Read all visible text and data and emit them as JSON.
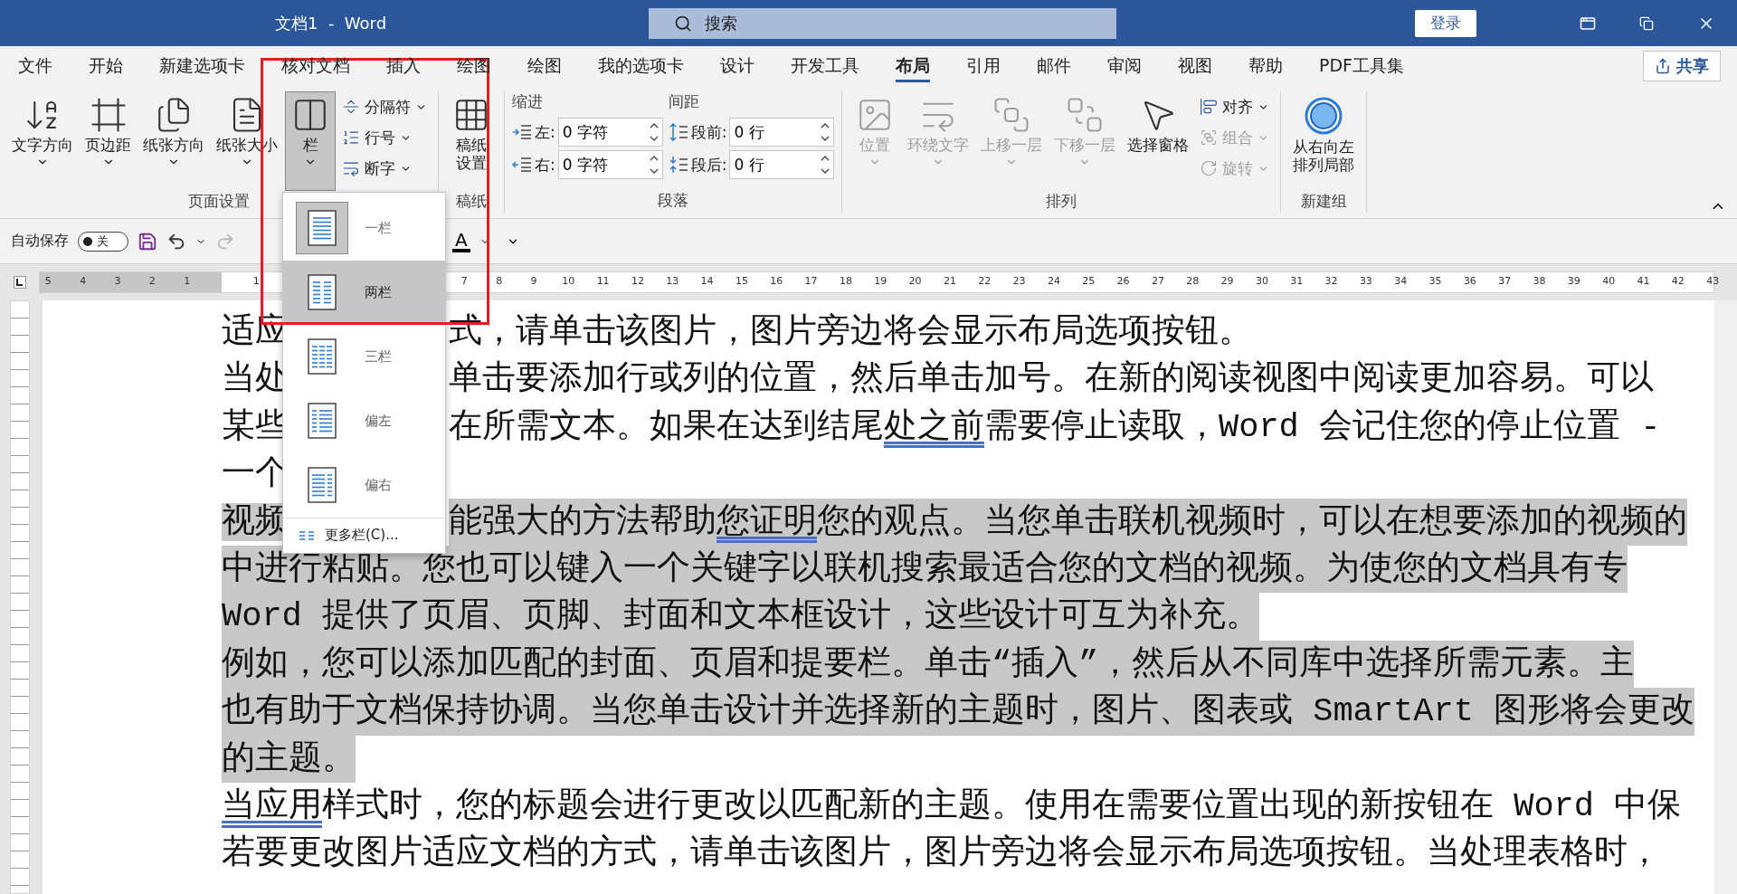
{
  "title_bar": {
    "title": "文档1  -  Word",
    "search": {
      "placeholder": "搜索"
    },
    "sign_in": "登录"
  },
  "tabs": [
    {
      "label": "文件",
      "selected": false
    },
    {
      "label": "开始",
      "selected": false
    },
    {
      "label": "新建选项卡",
      "selected": false
    },
    {
      "label": "核对文档",
      "selected": false
    },
    {
      "label": "插入",
      "selected": false
    },
    {
      "label": "绘图",
      "selected": false
    },
    {
      "label": "绘图",
      "selected": false
    },
    {
      "label": "我的选项卡",
      "selected": false
    },
    {
      "label": "设计",
      "selected": false
    },
    {
      "label": "开发工具",
      "selected": false
    },
    {
      "label": "布局",
      "selected": true
    },
    {
      "label": "引用",
      "selected": false
    },
    {
      "label": "邮件",
      "selected": false
    },
    {
      "label": "审阅",
      "selected": false
    },
    {
      "label": "视图",
      "selected": false
    },
    {
      "label": "帮助",
      "selected": false
    },
    {
      "label": "PDF工具集",
      "selected": false
    }
  ],
  "share": "共享",
  "ribbon": {
    "groups": [
      {
        "kind": "buttons",
        "label": "页面设置",
        "large": [
          {
            "label": "文字方向",
            "dropdown": true,
            "pressed": false,
            "disabled": false
          },
          {
            "label": "页边距",
            "dropdown": true,
            "pressed": false,
            "disabled": false
          },
          {
            "label": "纸张方向",
            "dropdown": true,
            "pressed": false,
            "disabled": false
          },
          {
            "label": "纸张大小",
            "dropdown": true,
            "pressed": false,
            "disabled": false
          },
          {
            "label": "栏",
            "dropdown": true,
            "pressed": true,
            "disabled": false
          }
        ],
        "small": [
          {
            "label": "分隔符",
            "dropdown": true,
            "disabled": false
          },
          {
            "label": "行号",
            "dropdown": true,
            "disabled": false
          },
          {
            "label": "断字",
            "dropdown": true,
            "disabled": false
          }
        ]
      },
      {
        "kind": "buttons",
        "label": "稿纸",
        "large": [
          {
            "label": "稿纸设置",
            "two_lines": true,
            "dropdown": false,
            "pressed": false,
            "disabled": false
          }
        ]
      },
      {
        "kind": "paragraph",
        "label": "段落",
        "indent_heading": "缩进",
        "spacing_heading": "间距",
        "indent": [
          {
            "label": "左:",
            "value": "0 字符"
          },
          {
            "label": "右:",
            "value": "0 字符"
          }
        ],
        "spacing": [
          {
            "label": "段前:",
            "value": "0 行"
          },
          {
            "label": "段后:",
            "value": "0 行"
          }
        ]
      },
      {
        "kind": "buttons",
        "label": "排列",
        "large": [
          {
            "label": "位置",
            "dropdown": true,
            "pressed": false,
            "disabled": true
          },
          {
            "label": "环绕文字",
            "dropdown": true,
            "pressed": false,
            "disabled": true
          },
          {
            "label": "上移一层",
            "dropdown": true,
            "pressed": false,
            "disabled": true
          },
          {
            "label": "下移一层",
            "dropdown": true,
            "pressed": false,
            "disabled": true
          },
          {
            "label": "选择窗格",
            "dropdown": false,
            "pressed": false,
            "disabled": false
          }
        ],
        "small": [
          {
            "label": "对齐",
            "dropdown": true,
            "disabled": false
          },
          {
            "label": "组合",
            "dropdown": true,
            "disabled": true
          },
          {
            "label": "旋转",
            "dropdown": true,
            "disabled": true
          }
        ]
      },
      {
        "kind": "buttons",
        "label": "新建组",
        "large": [
          {
            "label": "从右向左排列局部",
            "two_lines": true,
            "dropdown": false,
            "pressed": false,
            "disabled": false
          }
        ]
      }
    ]
  },
  "quick_access": {
    "autosave": "自动保存",
    "toggle": {
      "label": "关",
      "on": false
    },
    "font_color": "A"
  },
  "ruler": {
    "left_numbers": [
      "5",
      "4",
      "3",
      "2",
      "1"
    ],
    "right_numbers_before_menu": [
      "1"
    ],
    "right_numbers": [
      "7",
      "8",
      "9",
      "10",
      "11",
      "12",
      "13",
      "14",
      "15",
      "16",
      "17",
      "18",
      "19",
      "20",
      "21",
      "22",
      "23",
      "24",
      "25",
      "26",
      "27",
      "28",
      "29",
      "30",
      "31",
      "32",
      "33",
      "34",
      "35",
      "36",
      "37",
      "38",
      "39",
      "40",
      "41",
      "42",
      "43"
    ]
  },
  "columns_menu": {
    "items": [
      {
        "label": "一栏",
        "selected": true,
        "hovered": false
      },
      {
        "label": "两栏",
        "selected": false,
        "hovered": true
      },
      {
        "label": "三栏",
        "selected": false,
        "hovered": false
      },
      {
        "label": "偏左",
        "selected": false,
        "hovered": false
      },
      {
        "label": "偏右",
        "selected": false,
        "hovered": false
      }
    ],
    "more": "更多栏(C)..."
  },
  "document": {
    "lines": [
      {
        "selected": false,
        "left": "适应",
        "parts": [
          {
            "text": "式，请单击该图片，图片旁边将会显示布局选项按钮。",
            "underlined": false
          }
        ]
      },
      {
        "selected": false,
        "left": "当处",
        "parts": [
          {
            "text": " 单击要添加行或列的位置，然后单击加号。在新的阅读视图中阅读更加容易。可以",
            "underlined": false
          }
        ]
      },
      {
        "selected": false,
        "left": "某些",
        "parts": [
          {
            "text": "在所需文本。如果在达到结尾",
            "underlined": false
          },
          {
            "text": "处之前",
            "underlined": true
          },
          {
            "text": "需要停止读取，Word 会记住您的停止位置 -",
            "underlined": false
          }
        ]
      },
      {
        "selected": false,
        "left": "一个"
      },
      {
        "selected": true,
        "left": "视频",
        "parts": [
          {
            "text": "能强大的方法帮助",
            "underlined": false
          },
          {
            "text": "您证明",
            "underlined": true
          },
          {
            "text": "您的观点。当您单击联机视频时，可以在想要添加的视频的",
            "underlined": false
          }
        ]
      },
      {
        "selected": true,
        "parts": [
          {
            "text": "中进行粘贴。您也可以键入一个关键字以联机搜索最适合您的文档的视频。为使您的文档具有专",
            "underlined": false
          }
        ]
      },
      {
        "selected": true,
        "parts": [
          {
            "text": "Word 提供了页眉、页脚、封面和文本框设计，这些设计可互为补充。",
            "underlined": false
          }
        ]
      },
      {
        "selected": true,
        "parts": [
          {
            "text": "例如，您可以添加匹配的封面、页眉和提要栏。单击“插入”，然后从不同库中选择所需元素。主",
            "underlined": false
          }
        ]
      },
      {
        "selected": true,
        "parts": [
          {
            "text": "也有助于文档保持协调。当您单击设计并选择新的主题时，图片、图表或 SmartArt 图形将会更改",
            "underlined": false
          }
        ]
      },
      {
        "selected": true,
        "parts": [
          {
            "text": "的主题。",
            "underlined": false
          }
        ]
      },
      {
        "selected": false,
        "parts": [
          {
            "text": "当应用",
            "underlined": true
          },
          {
            "text": "样式时，您的标题会进行更改以匹配新的主题。使用在需要位置出现的新按钮在 Word 中保",
            "underlined": false
          }
        ]
      },
      {
        "selected": false,
        "parts": [
          {
            "text": "若要更改图片适应文档的方式，请单击该图片，图片旁边将会显示布局选项按钮。当处理表格时，",
            "underlined": false
          }
        ]
      }
    ]
  }
}
